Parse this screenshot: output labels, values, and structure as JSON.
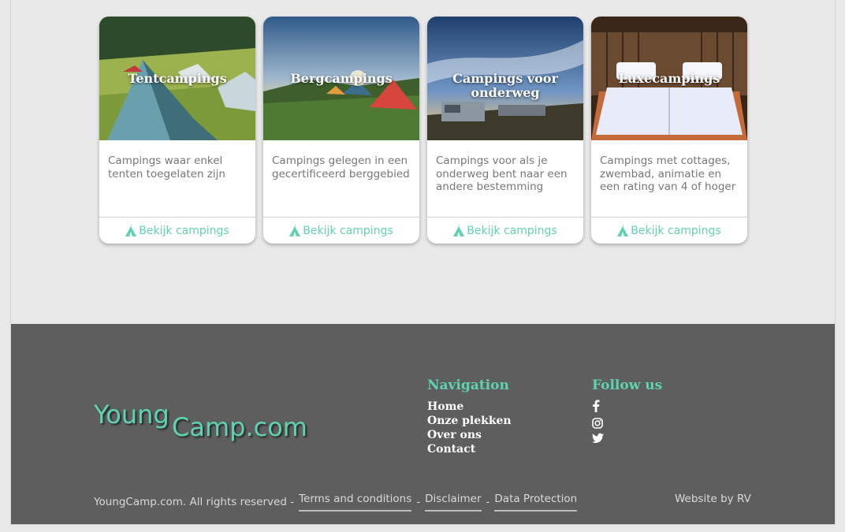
{
  "cards": [
    {
      "title": "Tentcampings",
      "description": "Campings waar enkel tenten toegelaten zijn",
      "link_label": "Bekijk campings"
    },
    {
      "title": "Bergcampings",
      "description": "Campings gelegen in een gecertificeerd berggebied",
      "link_label": "Bekijk campings"
    },
    {
      "title": "Campings voor onderweg",
      "description": "Campings voor als je onderweg bent naar een andere bestemming",
      "link_label": "Bekijk campings"
    },
    {
      "title": "Luxecampings",
      "description": "Campings met cottages, zwembad, animatie en een rating van 4 of hoger",
      "link_label": "Bekijk campings"
    }
  ],
  "footer": {
    "logo_part1": "Young",
    "logo_part2": "Camp.com",
    "navigation_title": "Navigation",
    "navigation": [
      "Home",
      "Onze plekken",
      "Over ons",
      "Contact"
    ],
    "follow_title": "Follow us",
    "social_icons": [
      "facebook-icon",
      "instagram-icon",
      "twitter-icon"
    ],
    "copyright": "YoungCamp.com. All rights reserved -",
    "links": [
      "Terms and conditions",
      "Disclaimer",
      "Data Protection"
    ],
    "separator": "-",
    "credit": "Website by RV"
  },
  "colors": {
    "accent": "#5fd3b0",
    "footer_bg": "#5e5e5e",
    "page_bg": "#e9e9e9"
  }
}
